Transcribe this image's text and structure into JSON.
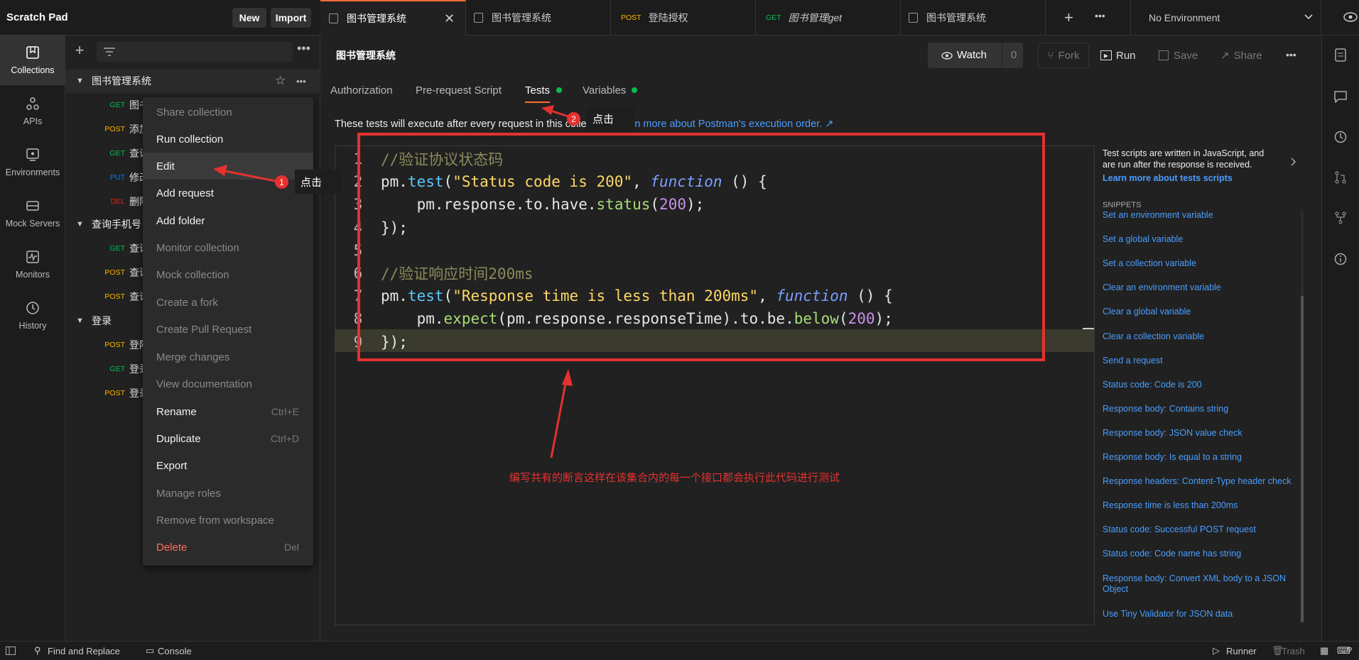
{
  "header": {
    "workspace": "Scratch Pad",
    "new_label": "New",
    "import_label": "Import"
  },
  "rail": [
    {
      "label": "Collections",
      "icon": "collections-icon"
    },
    {
      "label": "APIs",
      "icon": "apis-icon"
    },
    {
      "label": "Environments",
      "icon": "environments-icon"
    },
    {
      "label": "Mock Servers",
      "icon": "mock-servers-icon"
    },
    {
      "label": "Monitors",
      "icon": "monitors-icon"
    },
    {
      "label": "History",
      "icon": "history-icon"
    }
  ],
  "sidebar": {
    "collection1": "图书管理系统",
    "c1_items": [
      {
        "method": "GET",
        "name": "图书"
      },
      {
        "method": "POST",
        "name": "添加"
      },
      {
        "method": "GET",
        "name": "查询"
      },
      {
        "method": "PUT",
        "name": "修改"
      },
      {
        "method": "DEL",
        "name": "删除"
      }
    ],
    "collection2": "查询手机号",
    "c2_items": [
      {
        "method": "GET",
        "name": "查询"
      },
      {
        "method": "POST",
        "name": "查询"
      },
      {
        "method": "POST",
        "name": "查询"
      }
    ],
    "collection3": "登录",
    "c3_items": [
      {
        "method": "POST",
        "name": "登陆"
      },
      {
        "method": "GET",
        "name": "登录"
      },
      {
        "method": "POST",
        "name": "登录"
      }
    ]
  },
  "context_menu": [
    {
      "label": "Share collection",
      "shortcut": "",
      "enabled": false
    },
    {
      "label": "Run collection",
      "shortcut": "",
      "enabled": true
    },
    {
      "label": "Edit",
      "shortcut": "",
      "enabled": true
    },
    {
      "label": "Add request",
      "shortcut": "",
      "enabled": true
    },
    {
      "label": "Add folder",
      "shortcut": "",
      "enabled": true
    },
    {
      "label": "Monitor collection",
      "shortcut": "",
      "enabled": false
    },
    {
      "label": "Mock collection",
      "shortcut": "",
      "enabled": false
    },
    {
      "label": "Create a fork",
      "shortcut": "",
      "enabled": false
    },
    {
      "label": "Create Pull Request",
      "shortcut": "",
      "enabled": false
    },
    {
      "label": "Merge changes",
      "shortcut": "",
      "enabled": false
    },
    {
      "label": "View documentation",
      "shortcut": "",
      "enabled": false
    },
    {
      "label": "Rename",
      "shortcut": "Ctrl+E",
      "enabled": true
    },
    {
      "label": "Duplicate",
      "shortcut": "Ctrl+D",
      "enabled": true
    },
    {
      "label": "Export",
      "shortcut": "",
      "enabled": true
    },
    {
      "label": "Manage roles",
      "shortcut": "",
      "enabled": false
    },
    {
      "label": "Remove from workspace",
      "shortcut": "",
      "enabled": false
    },
    {
      "label": "Delete",
      "shortcut": "Del",
      "enabled": true
    }
  ],
  "tabs": [
    {
      "method": "",
      "label": "图书管理系统",
      "active": true
    },
    {
      "method": "",
      "label": "图书管理系统",
      "active": false
    },
    {
      "method": "POST",
      "label": "登陆授权",
      "active": false
    },
    {
      "method": "GET",
      "label": "图书管理get",
      "active": false
    },
    {
      "method": "",
      "label": "图书管理系统",
      "active": false
    }
  ],
  "environment": "No Environment",
  "main": {
    "title": "图书管理系统",
    "watch_label": "Watch",
    "watch_count": "0",
    "fork_label": "Fork",
    "run_label": "Run",
    "save_label": "Save",
    "share_label": "Share",
    "subtabs": [
      "Authorization",
      "Pre-request Script",
      "Tests",
      "Variables"
    ],
    "info_text": "These tests will execute after every request in this collection.",
    "info_link": "Learn more about Postman's execution order. ↗"
  },
  "code_lines": [
    "//验证协议状态码",
    "pm.test(\"Status code is 200\", function () {",
    "    pm.response.to.have.status(200);",
    "});",
    "",
    "//验证响应时间200ms",
    "pm.test(\"Response time is less than 200ms\", function () {",
    "    pm.expect(pm.response.responseTime).to.be.below(200);",
    "});"
  ],
  "snippets_panel": {
    "intro": "Test scripts are written in JavaScript, and are run after the response is received.",
    "learn_link": "Learn more about tests scripts",
    "heading": "SNIPPETS",
    "items": [
      "Set an environment variable",
      "Set a global variable",
      "Set a collection variable",
      "Clear an environment variable",
      "Clear a global variable",
      "Clear a collection variable",
      "Send a request",
      "Status code: Code is 200",
      "Response body: Contains string",
      "Response body: JSON value check",
      "Response body: Is equal to a string",
      "Response headers: Content-Type header check",
      "Response time is less than 200ms",
      "Status code: Successful POST request",
      "Status code: Code name has string",
      "Response body: Convert XML body to a JSON Object",
      "Use Tiny Validator for JSON data"
    ]
  },
  "annotations": {
    "click1": "点击",
    "click2": "点击",
    "badge1": "1",
    "badge2": "2",
    "note": "编写共有的断言这样在该集合内的每一个接口都会执行此代码进行测试"
  },
  "status_bar": {
    "find_replace": "Find and Replace",
    "console": "Console",
    "runner": "Runner",
    "trash": "Trash"
  },
  "colors": {
    "accent": "#ff6c37",
    "annotation_red": "#e5312f",
    "link": "#4a9eff",
    "get": "#0cbb52",
    "post": "#ffb400",
    "put": "#097bed",
    "del": "#eb2013"
  }
}
